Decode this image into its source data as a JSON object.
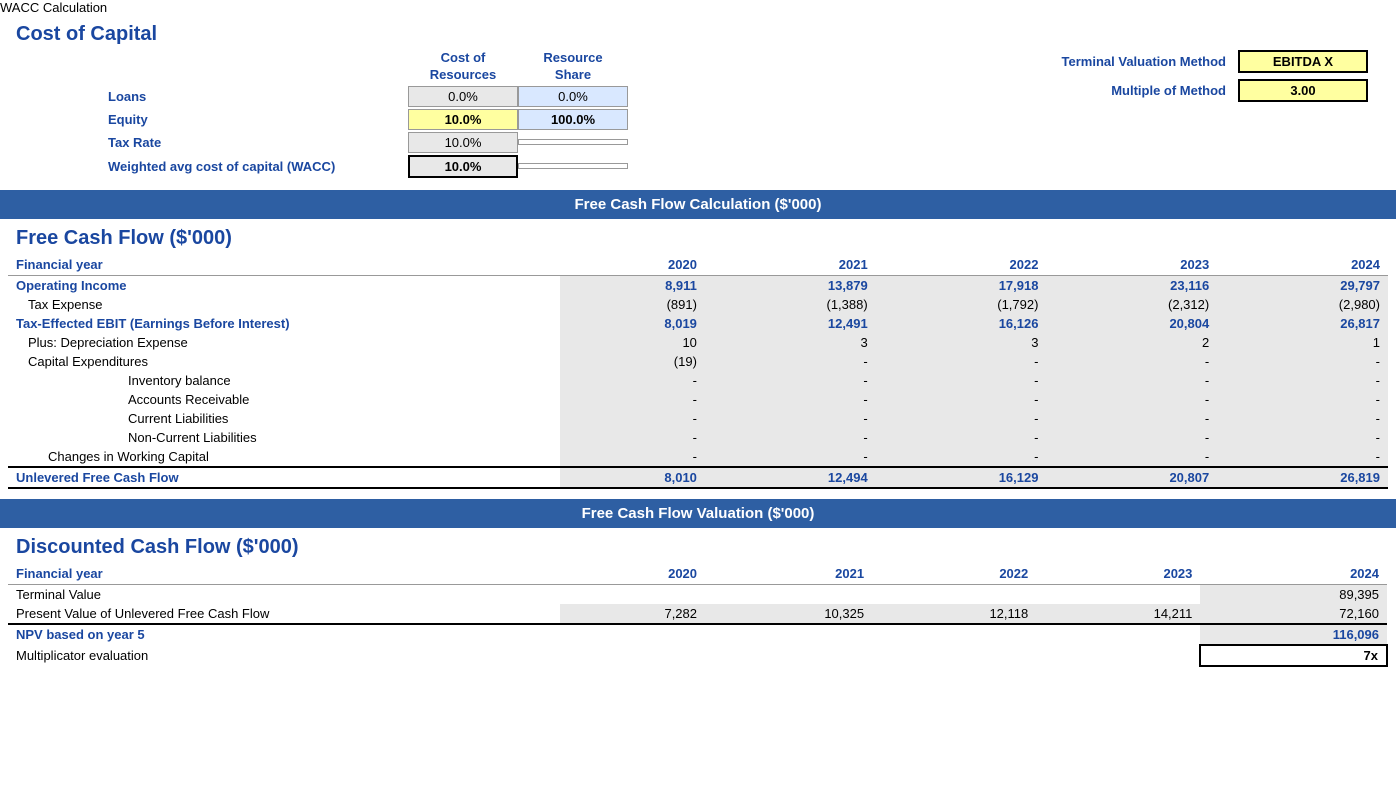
{
  "title": "WACC Calculation",
  "cost_of_capital": {
    "section_title": "Cost of Capital",
    "col_headers": [
      "Cost of Resources",
      "Resource Share"
    ],
    "rows": [
      {
        "label": "Loans",
        "cost": "0.0%",
        "share": "0.0%"
      },
      {
        "label": "Equity",
        "cost": "10.0%",
        "share": "100.0%"
      },
      {
        "label": "Tax Rate",
        "cost": "10.0%",
        "share": ""
      },
      {
        "label": "Weighted avg cost of capital (WACC)",
        "cost": "10.0%",
        "share": ""
      }
    ],
    "terminal": {
      "method_label": "Terminal Valuation Method",
      "method_value": "EBITDA X",
      "multiple_label": "Multiple of Method",
      "multiple_value": "3.00"
    }
  },
  "fcf_section": {
    "header": "Free Cash Flow Calculation ($'000)",
    "section_title": "Free Cash Flow ($'000)",
    "col_headers": [
      "Financial year",
      "2020",
      "2021",
      "2022",
      "2023",
      "2024"
    ],
    "rows": [
      {
        "type": "bold",
        "label": "Operating Income",
        "indent": 0,
        "values": [
          "8,911",
          "13,879",
          "17,918",
          "23,116",
          "29,797"
        ]
      },
      {
        "type": "normal",
        "label": "Tax Expense",
        "indent": 1,
        "values": [
          "(891)",
          "(1,388)",
          "(1,792)",
          "(2,312)",
          "(2,980)"
        ]
      },
      {
        "type": "bold",
        "label": "Tax-Effected EBIT (Earnings Before Interest)",
        "indent": 0,
        "values": [
          "8,019",
          "12,491",
          "16,126",
          "20,804",
          "26,817"
        ]
      },
      {
        "type": "normal",
        "label": "Plus: Depreciation Expense",
        "indent": 1,
        "values": [
          "10",
          "3",
          "3",
          "2",
          "1"
        ]
      },
      {
        "type": "normal",
        "label": "Capital Expenditures",
        "indent": 1,
        "values": [
          "(19)",
          "-",
          "-",
          "-",
          "-"
        ]
      },
      {
        "type": "normal",
        "label": "Inventory balance",
        "indent": 3,
        "values": [
          "-",
          "-",
          "-",
          "-",
          "-"
        ]
      },
      {
        "type": "normal",
        "label": "Accounts Receivable",
        "indent": 3,
        "values": [
          "-",
          "-",
          "-",
          "-",
          "-"
        ]
      },
      {
        "type": "normal",
        "label": "Current Liabilities",
        "indent": 3,
        "values": [
          "-",
          "-",
          "-",
          "-",
          "-"
        ]
      },
      {
        "type": "normal",
        "label": "Non-Current Liabilities",
        "indent": 3,
        "values": [
          "-",
          "-",
          "-",
          "-",
          "-"
        ]
      },
      {
        "type": "normal",
        "label": "Changes in Working Capital",
        "indent": 2,
        "values": [
          "-",
          "-",
          "-",
          "-",
          "-"
        ]
      },
      {
        "type": "unlevered",
        "label": "Unlevered Free Cash Flow",
        "indent": 0,
        "values": [
          "8,010",
          "12,494",
          "16,129",
          "20,807",
          "26,819"
        ]
      }
    ]
  },
  "dcf_section": {
    "header": "Free Cash Flow Valuation ($'000)",
    "section_title": "Discounted Cash Flow ($'000)",
    "col_headers": [
      "Financial year",
      "2020",
      "2021",
      "2022",
      "2023",
      "2024"
    ],
    "rows": [
      {
        "type": "normal",
        "label": "Terminal Value",
        "values": [
          "",
          "",
          "",
          "",
          "89,395"
        ]
      },
      {
        "type": "normal",
        "label": "Present Value of Unlevered Free Cash Flow",
        "values": [
          "7,282",
          "10,325",
          "12,118",
          "14,211",
          "72,160"
        ]
      },
      {
        "type": "npv",
        "label": "NPV based on year 5",
        "values": [
          "",
          "",
          "",
          "",
          "116,096"
        ]
      },
      {
        "type": "multi",
        "label": "Multiplicator evaluation",
        "values": [
          "",
          "",
          "",
          "",
          "7x"
        ]
      }
    ]
  }
}
